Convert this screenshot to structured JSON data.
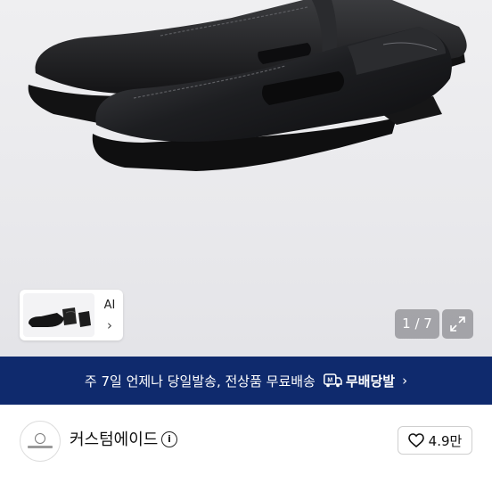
{
  "gallery": {
    "thumbnail_label": "AI",
    "thumbnail_chevron": "›",
    "counter_text": "1 / 7",
    "current_page": 1,
    "total_pages": 7
  },
  "banner": {
    "text": "주 7일 언제나 당일발송, 전상품 무료배송",
    "badge_label": "무배당발",
    "badge_icon_text": "M",
    "chevron": "›",
    "background_color": "#0f2a6d"
  },
  "seller": {
    "name": "커스텀에이드",
    "info_icon": "i",
    "like_count": "4.9만"
  },
  "icons": [
    "shoe-photo",
    "expand-icon",
    "info-icon",
    "heart-icon",
    "chevron-right-icon",
    "delivery-truck-icon"
  ]
}
